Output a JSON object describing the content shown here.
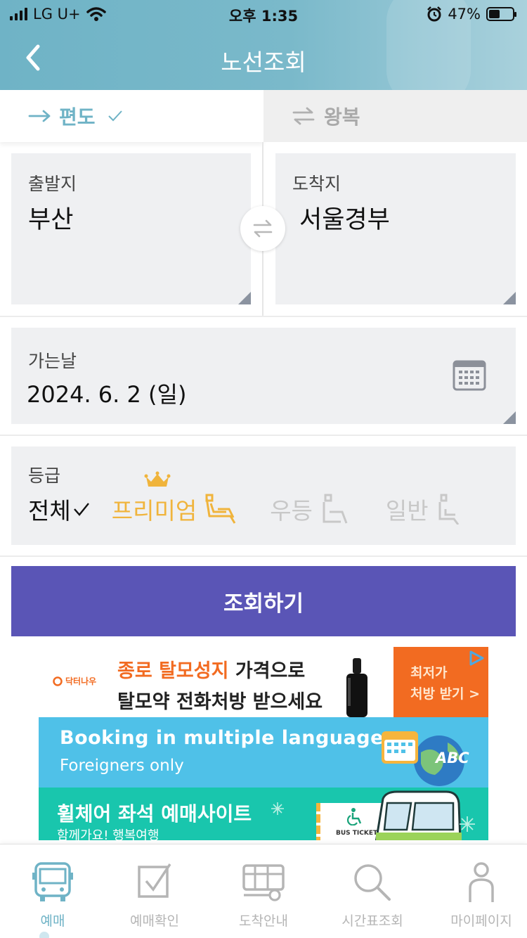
{
  "status_bar": {
    "carrier": "LG U+",
    "time": "오후 1:35",
    "battery": "47%",
    "battery_level": 0.47
  },
  "header": {
    "title": "노선조회"
  },
  "trip_tabs": {
    "oneway": "편도",
    "roundtrip": "왕복"
  },
  "departure": {
    "label": "출발지",
    "value": "부산"
  },
  "arrival": {
    "label": "도착지",
    "value": "서울경부"
  },
  "date": {
    "label": "가는날",
    "value": "2024. 6. 2 (일)"
  },
  "grade": {
    "label": "등급",
    "options": [
      "전체",
      "프리미엄",
      "우등",
      "일반"
    ]
  },
  "search_button": "조회하기",
  "ads": {
    "ad1_brand": "닥터나우",
    "ad1_line1_highlight": "종로 탈모성지",
    "ad1_line1_rest": " 가격으로",
    "ad1_line2": "탈모약 전화처방 받으세요",
    "ad1_cta_line1": "최저가",
    "ad1_cta_line2": "처방 받기 >",
    "ad2_title": "Booking in multiple languages",
    "ad2_subtitle": "Foreigners only",
    "ad2_badge": "ABC",
    "ad3_title": "휠체어 좌석 예매사이트",
    "ad3_subtitle": "함께가요! 행복여행",
    "ad3_ticket": "BUS TICKET"
  },
  "tab_bar": [
    "예매",
    "예매확인",
    "도착안내",
    "시간표조회",
    "마이페이지"
  ],
  "colors": {
    "accent": "#6fb3c6",
    "primary_button": "#5a55b6",
    "premium": "#f0b43c",
    "card_bg": "#eff0f2"
  }
}
